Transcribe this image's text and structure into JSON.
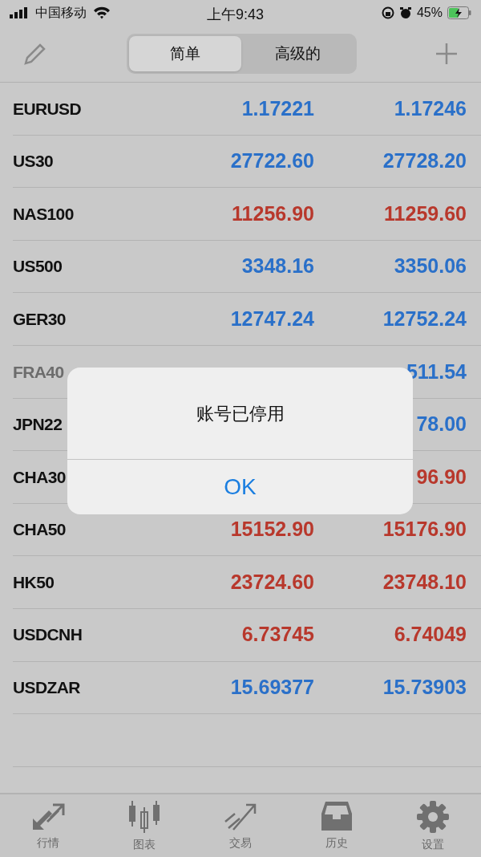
{
  "status_bar": {
    "carrier": "中国移动",
    "time": "上午9:43",
    "battery": "45%"
  },
  "segments": [
    {
      "label": "简单",
      "selected": true
    },
    {
      "label": "高级的",
      "selected": false
    }
  ],
  "quotes": [
    {
      "symbol": "EURUSD",
      "bid": "1.17221",
      "ask": "1.17246",
      "color": "#2a70c9",
      "disabled": false
    },
    {
      "symbol": "US30",
      "bid": "27722.60",
      "ask": "27728.20",
      "color": "#2a70c9",
      "disabled": false
    },
    {
      "symbol": "NAS100",
      "bid": "11256.90",
      "ask": "11259.60",
      "color": "#b8382c",
      "disabled": false
    },
    {
      "symbol": "US500",
      "bid": "3348.16",
      "ask": "3350.06",
      "color": "#2a70c9",
      "disabled": false
    },
    {
      "symbol": "GER30",
      "bid": "12747.24",
      "ask": "12752.24",
      "color": "#2a70c9",
      "disabled": false
    },
    {
      "symbol": "FRA40",
      "ask": "511.54",
      "color": "#2a70c9",
      "disabled": true
    },
    {
      "symbol": "JPN22",
      "ask": "78.00",
      "color": "#2a70c9",
      "disabled": false
    },
    {
      "symbol": "CHA30",
      "ask": "96.90",
      "color": "#b8382c",
      "disabled": false
    },
    {
      "symbol": "CHA50",
      "bid": "15152.90",
      "ask": "15176.90",
      "color": "#b8382c",
      "disabled": false
    },
    {
      "symbol": "HK50",
      "bid": "23724.60",
      "ask": "23748.10",
      "color": "#b8382c",
      "disabled": false
    },
    {
      "symbol": "USDCNH",
      "bid": "6.73745",
      "ask": "6.74049",
      "color": "#b8382c",
      "disabled": false
    },
    {
      "symbol": "USDZAR",
      "bid": "15.69377",
      "ask": "15.73903",
      "color": "#2a70c9",
      "disabled": false
    }
  ],
  "alert": {
    "message": "账号已停用",
    "button": "OK"
  },
  "tab_bar": [
    {
      "label": "行情",
      "kind": "quotes"
    },
    {
      "label": "图表",
      "kind": "chart"
    },
    {
      "label": "交易",
      "kind": "trade"
    },
    {
      "label": "历史",
      "kind": "history"
    },
    {
      "label": "设置",
      "kind": "settings"
    }
  ]
}
